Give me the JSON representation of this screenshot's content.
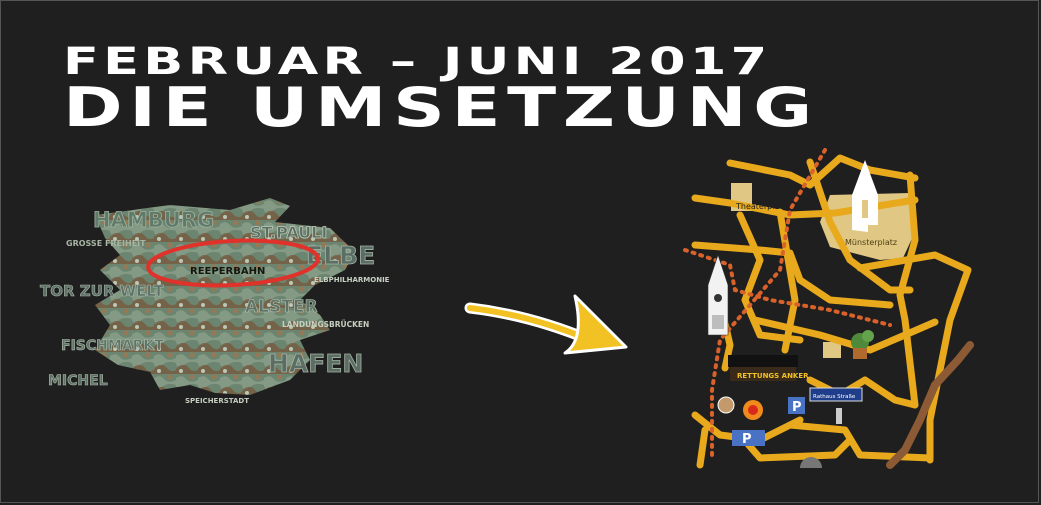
{
  "header": {
    "subtitle": "FEBRUAR – JUNI 2017",
    "title": "DIE UMSETZUNG"
  },
  "word_cloud": {
    "words": {
      "hamburg": "HAMBURG",
      "st_pauli": "ST.PAULI",
      "grosse_freiheit": "GROSSE FREIHEIT",
      "reeperbahn": "REEPERBAHN",
      "elbe": "ELBE",
      "elbphilharmonie": "ELBPHILHARMONIE",
      "tor_zur_welt": "TOR ZUR WELT",
      "alster": "ALSTER",
      "landungsbruecken": "LANDUNGSBRÜCKEN",
      "fischmarkt": "FISCHMARKT",
      "hafen": "HAFEN",
      "michel": "MICHEL",
      "speicherstadt": "SPEICHERSTADT"
    },
    "highlight_color": "#e0312a"
  },
  "city_map": {
    "labels": {
      "place_top": "Theaterplatz",
      "muensterplatz": "Münsterplatz",
      "sign_rettung": "RETTUNGS ANKER",
      "sign_street": "Rathaus Straße",
      "parking": "P"
    },
    "street_color": "#e8a91c",
    "path_color": "#d9622b"
  },
  "colors": {
    "background": "#1f1f1f",
    "arrow": "#f2c224",
    "camo_green": "#6f8a74",
    "camo_brown": "#7a5a3c"
  }
}
